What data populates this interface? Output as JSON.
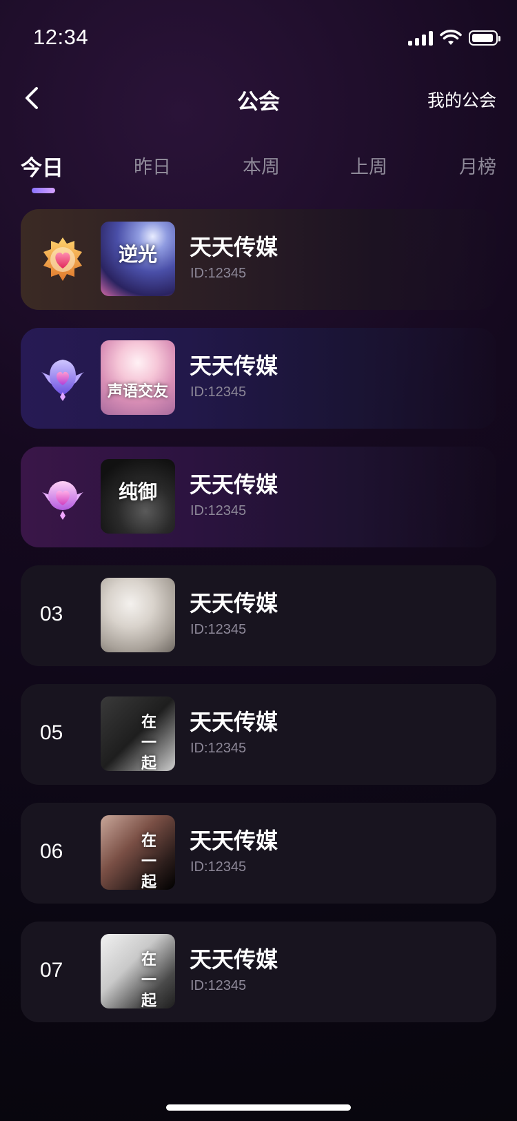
{
  "status_bar": {
    "time": "12:34"
  },
  "nav": {
    "title": "公会",
    "right_label": "我的公会"
  },
  "tabs": [
    {
      "label": "今日",
      "active": true
    },
    {
      "label": "昨日",
      "active": false
    },
    {
      "label": "本周",
      "active": false
    },
    {
      "label": "上周",
      "active": false
    },
    {
      "label": "月榜",
      "active": false
    }
  ],
  "guilds": [
    {
      "rank_icon": "gold-heart-badge-icon",
      "name": "天天传媒",
      "id": "ID:12345",
      "cover_text": "逆光"
    },
    {
      "rank_icon": "purple-heart-badge-icon",
      "name": "天天传媒",
      "id": "ID:12345",
      "cover_text": "声语交友"
    },
    {
      "rank_icon": "pink-heart-badge-icon",
      "name": "天天传媒",
      "id": "ID:12345",
      "cover_text": "纯御"
    },
    {
      "rank": "03",
      "name": "天天传媒",
      "id": "ID:12345",
      "cover_text": ""
    },
    {
      "rank": "05",
      "name": "天天传媒",
      "id": "ID:12345",
      "cover_text": "在一起"
    },
    {
      "rank": "06",
      "name": "天天传媒",
      "id": "ID:12345",
      "cover_text": "在一起"
    },
    {
      "rank": "07",
      "name": "天天传媒",
      "id": "ID:12345",
      "cover_text": "在一起"
    }
  ],
  "colors": {
    "accent": "#9b7bff",
    "muted_text": "#8d8898",
    "card_bg": "#18141f"
  }
}
